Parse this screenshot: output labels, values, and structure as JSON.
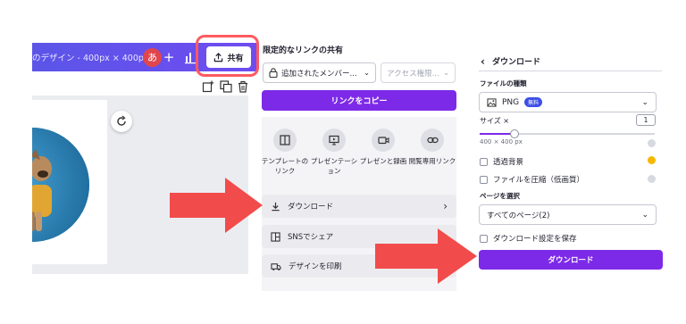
{
  "editor": {
    "doc_title": "のデザイン - 400px × 400px",
    "avatar_initial": "あ",
    "add_label": "+",
    "share_label": "共有",
    "accent": "#6f4cf0",
    "highlight_color": "#ff5a5f"
  },
  "share_menu": {
    "title": "限定的なリンクの共有",
    "member_select": "追加されたメンバー...",
    "access_select": "アクセス権限...",
    "copy_link_label": "リンクをコピー",
    "options": [
      {
        "label_1": "テンプレートの",
        "label_2": "リンク",
        "icon": "template-icon"
      },
      {
        "label_1": "プレゼンテーシ",
        "label_2": "ョン",
        "icon": "presentation-icon"
      },
      {
        "label_1": "プレゼンと録画",
        "label_2": "",
        "icon": "video-icon"
      },
      {
        "label_1": "閲覧専用リンク",
        "label_2": "",
        "icon": "link-icon"
      }
    ],
    "rows": [
      {
        "label": "ダウンロード",
        "icon": "download-icon"
      },
      {
        "label": "SNSでシェア",
        "icon": "sns-icon"
      },
      {
        "label": "デザインを印刷",
        "icon": "print-icon"
      }
    ]
  },
  "download_panel": {
    "title": "ダウンロード",
    "file_type_label": "ファイルの種類",
    "file_type_value": "PNG",
    "free_badge": "無料",
    "size_label": "サイズ ×",
    "size_value": "1",
    "size_fraction": 0.2,
    "size_dimensions": "400 × 400 px",
    "transparent_bg_label": "透過背景",
    "compress_label": "ファイルを圧縮（低画質）",
    "pages_label": "ページを選択",
    "pages_value": "すべてのページ(2)",
    "save_settings_label": "ダウンロード設定を保存",
    "download_button_label": "ダウンロード",
    "accent": "#7d2ae8",
    "crown_color": "#f5b800"
  },
  "annotation_arrow_color": "#f24b4b"
}
